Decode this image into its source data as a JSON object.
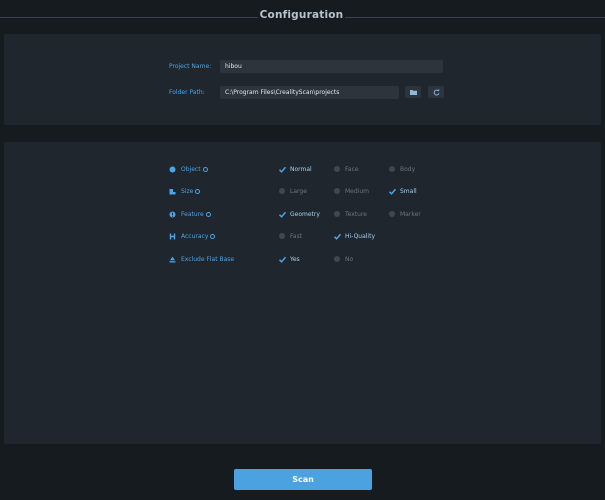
{
  "header": {
    "title": "Configuration"
  },
  "project": {
    "name_label": "Project Name:",
    "name_value": "hibou",
    "folder_label": "Folder Path:",
    "folder_value": "C:\\Program Files\\CrealityScan\\projects"
  },
  "icons": {
    "browse": "folder-icon",
    "reset": "refresh-icon"
  },
  "options": [
    {
      "label": "Object",
      "icon": "object-icon",
      "info": true,
      "choices": [
        {
          "label": "Normal",
          "checked": true
        },
        {
          "label": "Face",
          "checked": false
        },
        {
          "label": "Body",
          "checked": false
        }
      ]
    },
    {
      "label": "Size",
      "icon": "size-icon",
      "info": true,
      "choices": [
        {
          "label": "Large",
          "checked": false
        },
        {
          "label": "Medium",
          "checked": false
        },
        {
          "label": "Small",
          "checked": true
        }
      ]
    },
    {
      "label": "Feature",
      "icon": "feature-icon",
      "info": true,
      "choices": [
        {
          "label": "Geometry",
          "checked": true
        },
        {
          "label": "Texture",
          "checked": false
        },
        {
          "label": "Marker",
          "checked": false
        }
      ]
    },
    {
      "label": "Accuracy",
      "icon": "accuracy-icon",
      "info": true,
      "choices": [
        {
          "label": "Fast",
          "checked": false
        },
        {
          "label": "Hi-Quality",
          "checked": true
        }
      ]
    },
    {
      "label": "Exclude Flat Base",
      "icon": "flat-base-icon",
      "info": false,
      "choices": [
        {
          "label": "Yes",
          "checked": true
        },
        {
          "label": "No",
          "checked": false
        }
      ]
    }
  ],
  "actions": {
    "scan_label": "Scan"
  },
  "colors": {
    "accent": "#4aa6e8",
    "panel": "#1f262e",
    "background": "#161b20"
  }
}
